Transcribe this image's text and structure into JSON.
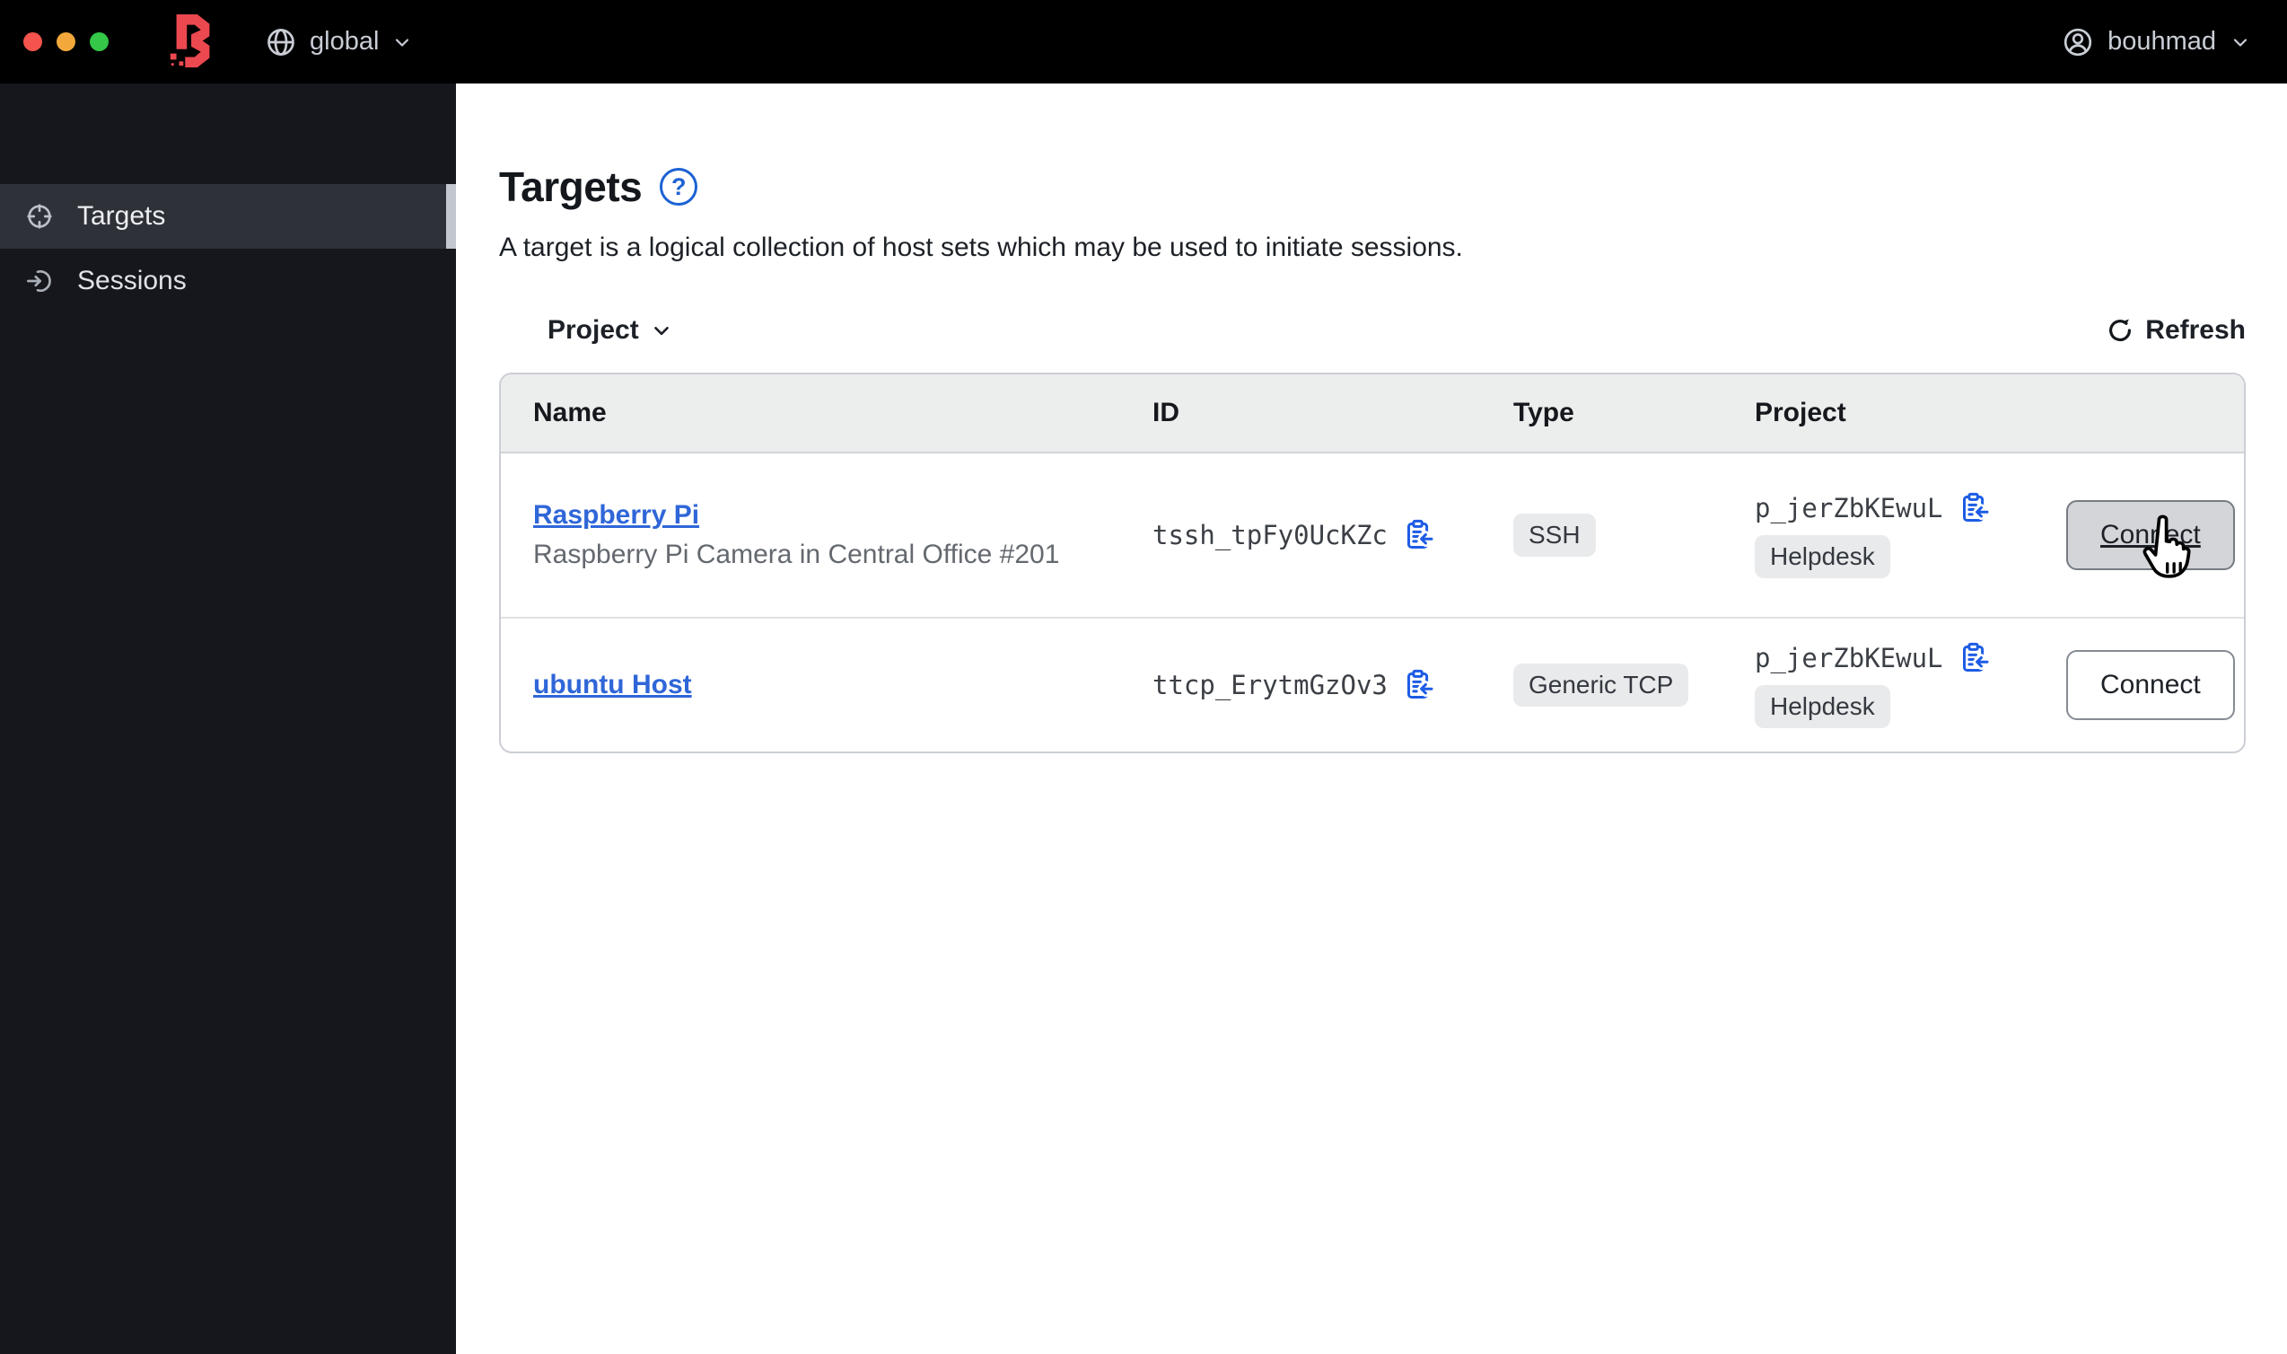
{
  "topbar": {
    "scope_label": "global",
    "user_label": "bouhmad"
  },
  "sidebar": {
    "items": [
      {
        "label": "Targets",
        "icon": "target-icon",
        "active": true
      },
      {
        "label": "Sessions",
        "icon": "session-icon",
        "active": false
      }
    ]
  },
  "main": {
    "title": "Targets",
    "help_glyph": "?",
    "description": "A target is a logical collection of host sets which may be used to initiate sessions.",
    "filter_label": "Project",
    "refresh_label": "Refresh",
    "table": {
      "columns": [
        "Name",
        "ID",
        "Type",
        "Project"
      ],
      "rows": [
        {
          "name": "Raspberry Pi",
          "description": "Raspberry Pi Camera in Central Office #201",
          "id": "tssh_tpFy0UcKZc",
          "type": "SSH",
          "project_id": "p_jerZbKEwuL",
          "project_name": "Helpdesk",
          "action": "Connect",
          "hovered": true
        },
        {
          "name": "ubuntu Host",
          "description": "",
          "id": "ttcp_ErytmGzOv3",
          "type": "Generic TCP",
          "project_id": "p_jerZbKEwuL",
          "project_name": "Helpdesk",
          "action": "Connect",
          "hovered": false
        }
      ]
    }
  },
  "colors": {
    "topbar-bg": "#000000",
    "sidebar-bg": "#15171c",
    "sidebar-active-bg": "#2e3138",
    "sidebar-indicator": "#c3c7ce",
    "logo-red": "#ec4850",
    "traffic-red": "#f4544d",
    "traffic-yellow": "#f2a83b",
    "traffic-green": "#34c748",
    "accent-blue": "#1c62d3",
    "link-blue": "#2f66d8",
    "copy-blue": "#1d5ce5",
    "badge-bg": "#e9eaeb",
    "header-bg": "#eceded"
  }
}
